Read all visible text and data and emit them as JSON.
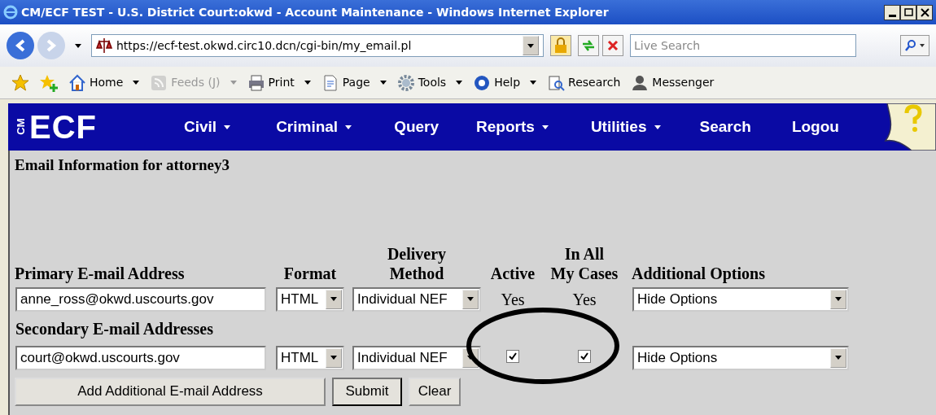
{
  "window": {
    "title": "CM/ECF TEST - U.S. District Court:okwd - Account Maintenance - Windows Internet Explorer"
  },
  "address_bar": {
    "url": "https://ecf-test.okwd.circ10.dcn/cgi-bin/my_email.pl"
  },
  "search": {
    "placeholder": "Live Search"
  },
  "command_bar": [
    {
      "kind": "home",
      "label": "Home",
      "disabled": false
    },
    {
      "kind": "feeds",
      "label": "Feeds (J)",
      "disabled": true
    },
    {
      "kind": "print",
      "label": "Print",
      "disabled": false
    },
    {
      "kind": "page",
      "label": "Page",
      "disabled": false
    },
    {
      "kind": "tools",
      "label": "Tools",
      "disabled": false
    },
    {
      "kind": "help",
      "label": "Help",
      "disabled": false
    },
    {
      "kind": "research",
      "label": "Research",
      "disabled": false
    },
    {
      "kind": "messenger",
      "label": "Messenger",
      "disabled": false
    }
  ],
  "ecf_menu": {
    "logo_prefix": "CM",
    "logo": "ECF",
    "items": [
      {
        "label": "Civil",
        "dropdown": true
      },
      {
        "label": "Criminal",
        "dropdown": true
      },
      {
        "label": "Query",
        "dropdown": false
      },
      {
        "label": "Reports",
        "dropdown": true
      },
      {
        "label": "Utilities",
        "dropdown": true
      },
      {
        "label": "Search",
        "dropdown": false
      },
      {
        "label": "Logou",
        "dropdown": false
      }
    ]
  },
  "page": {
    "heading": "Email Information for attorney3",
    "columns": [
      "Primary E-mail Address",
      "Format",
      "Delivery\nMethod",
      "Active",
      "In All\nMy Cases",
      "Additional Options"
    ],
    "primary": {
      "email": "anne_ross@okwd.uscourts.gov",
      "format": "HTML",
      "delivery": "Individual NEF",
      "active": "Yes",
      "in_all_cases": "Yes",
      "options": "Hide Options"
    },
    "secondary_label": "Secondary E-mail Addresses",
    "secondary": [
      {
        "email": "court@okwd.uscourts.gov",
        "format": "HTML",
        "delivery": "Individual NEF",
        "active": true,
        "in_all_cases": true,
        "options": "Hide Options"
      }
    ],
    "buttons": [
      "Add Additional E-mail Address",
      "Submit",
      "Clear"
    ]
  }
}
